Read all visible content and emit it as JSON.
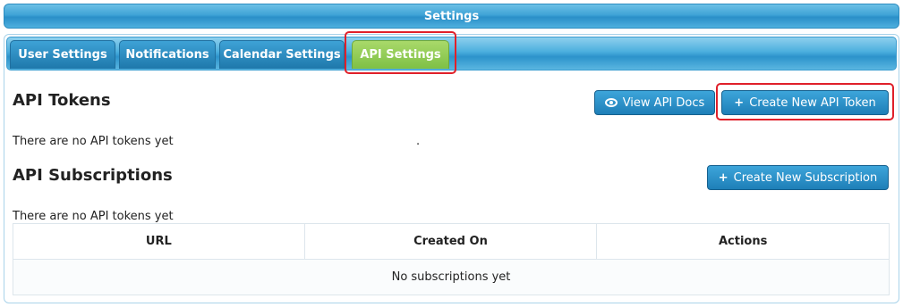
{
  "window": {
    "title": "Settings"
  },
  "tabs": [
    {
      "label": "User Settings"
    },
    {
      "label": "Notifications"
    },
    {
      "label": "Calendar Settings"
    },
    {
      "label": "API Settings"
    }
  ],
  "active_tab": "API Settings",
  "api_tokens": {
    "heading": "API Tokens",
    "view_docs_label": "View API Docs",
    "create_label": "Create New API Token",
    "empty_text": "There are no API tokens yet",
    "stray_dot": "."
  },
  "api_subscriptions": {
    "heading": "API Subscriptions",
    "create_label": "Create New Subscription",
    "empty_text": "There are no API tokens yet",
    "table": {
      "columns": [
        "URL",
        "Created On",
        "Actions"
      ],
      "empty_row": "No subscriptions yet"
    }
  },
  "icons": {
    "view_docs": "eye-icon",
    "create_token": "plus-icon",
    "create_subscription": "plus-icon"
  },
  "colors": {
    "primary_blue": "#2a8fc8",
    "active_tab_green": "#7ec045",
    "highlight_red": "#e0202a"
  }
}
